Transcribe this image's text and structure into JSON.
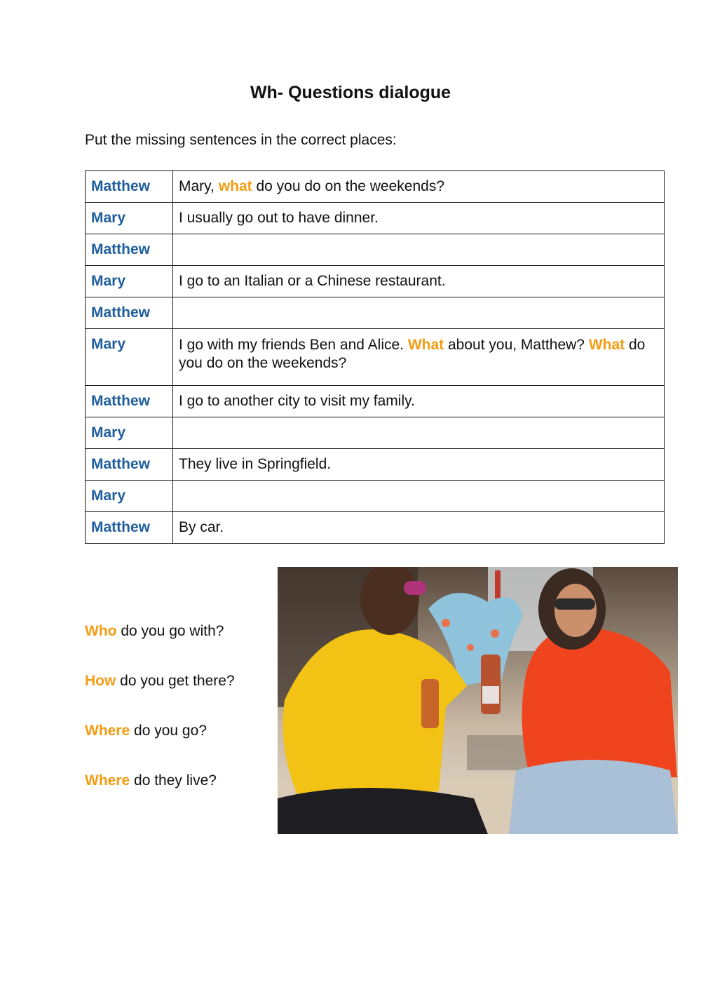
{
  "title": "Wh- Questions dialogue",
  "instruction": "Put the missing sentences in the correct places:",
  "colors": {
    "speaker": "#1f5f9e",
    "wh_word": "#f39c12",
    "text": "#111111"
  },
  "dialogue": [
    {
      "speaker": "Matthew",
      "line": [
        {
          "t": "Mary, "
        },
        {
          "t": "what",
          "wh": true
        },
        {
          "t": " do you do on the weekends?"
        }
      ]
    },
    {
      "speaker": "Mary",
      "line": [
        {
          "t": "I usually go out to have dinner."
        }
      ]
    },
    {
      "speaker": "Matthew",
      "line": []
    },
    {
      "speaker": "Mary",
      "line": [
        {
          "t": "I go to an Italian or a Chinese restaurant."
        }
      ]
    },
    {
      "speaker": "Matthew",
      "line": []
    },
    {
      "speaker": "Mary",
      "line": [
        {
          "t": "I go with my friends Ben and Alice. "
        },
        {
          "t": "What",
          "wh": true
        },
        {
          "t": " about you, Matthew? "
        },
        {
          "t": "What",
          "wh": true
        },
        {
          "t": " do you do on the weekends?"
        }
      ]
    },
    {
      "speaker": "Matthew",
      "line": [
        {
          "t": "I go to another city to visit my family."
        }
      ]
    },
    {
      "speaker": "Mary",
      "line": []
    },
    {
      "speaker": "Matthew",
      "line": [
        {
          "t": "They live in Springfield."
        }
      ]
    },
    {
      "speaker": "Mary",
      "line": []
    },
    {
      "speaker": "Matthew",
      "line": [
        {
          "t": "By car."
        }
      ]
    }
  ],
  "missing_sentences": [
    {
      "wh": "Who",
      "rest": " do you go with?"
    },
    {
      "wh": "How",
      "rest": " do you get there?"
    },
    {
      "wh": "Where",
      "rest": " do you go?"
    },
    {
      "wh": "Where",
      "rest": " do they live?"
    }
  ],
  "photo": {
    "description": "Two friends sitting on a bench toasting with bottled drinks; man in yellow t-shirt, woman in red t-shirt"
  }
}
